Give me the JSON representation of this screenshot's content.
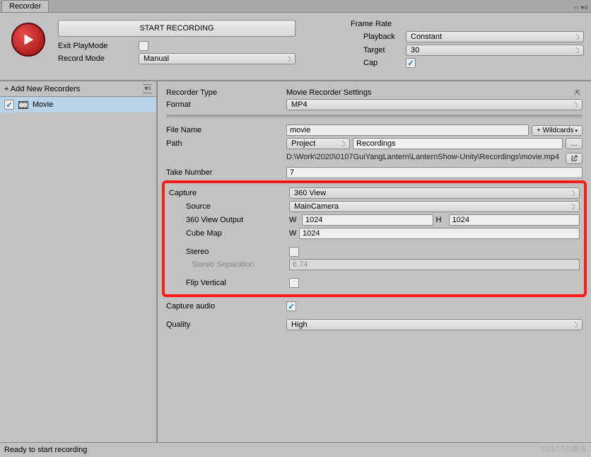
{
  "tab": {
    "title": "Recorder"
  },
  "top": {
    "start_label": "START RECORDING",
    "exit_playmode_label": "Exit PlayMode",
    "exit_playmode_checked": false,
    "record_mode_label": "Record Mode",
    "record_mode_value": "Manual"
  },
  "frame_rate": {
    "title": "Frame Rate",
    "playback_label": "Playback",
    "playback_value": "Constant",
    "target_label": "Target",
    "target_value": "30",
    "cap_label": "Cap",
    "cap_checked": true
  },
  "sidebar": {
    "add_label": "+ Add New Recorders",
    "item": {
      "label": "Movie",
      "checked": true
    }
  },
  "inspector": {
    "recorder_type_label": "Recorder Type",
    "recorder_type_value": "Movie Recorder Settings",
    "format_label": "Format",
    "format_value": "MP4",
    "filename_label": "File Name",
    "filename_value": "movie",
    "wildcards_label": "+ Wildcards",
    "path_label": "Path",
    "path_select_value": "Project",
    "path_input_value": "Recordings",
    "browse_label": "...",
    "path_display": "D:\\Work\\2020\\0107GuiYangLantern\\LanternShow-Unity\\Recordings\\movie.mp4",
    "take_label": "Take Number",
    "take_value": "7",
    "capture": {
      "title": "Capture",
      "value": "360 View",
      "source_label": "Source",
      "source_value": "MainCamera",
      "output_label": "360 View Output",
      "output_w": "1024",
      "output_h": "1024",
      "cubemap_label": "Cube Map",
      "cubemap_w": "1024",
      "stereo_label": "Stereo",
      "stereo_checked": false,
      "separation_label": "Stereo Separation",
      "separation_value": "6.74",
      "flip_label": "Flip Vertical",
      "flip_checked": false
    },
    "capture_audio_label": "Capture audio",
    "capture_audio_checked": true,
    "quality_label": "Quality",
    "quality_value": "High"
  },
  "status": "Ready to start recording",
  "watermark": "©51CTO博客"
}
